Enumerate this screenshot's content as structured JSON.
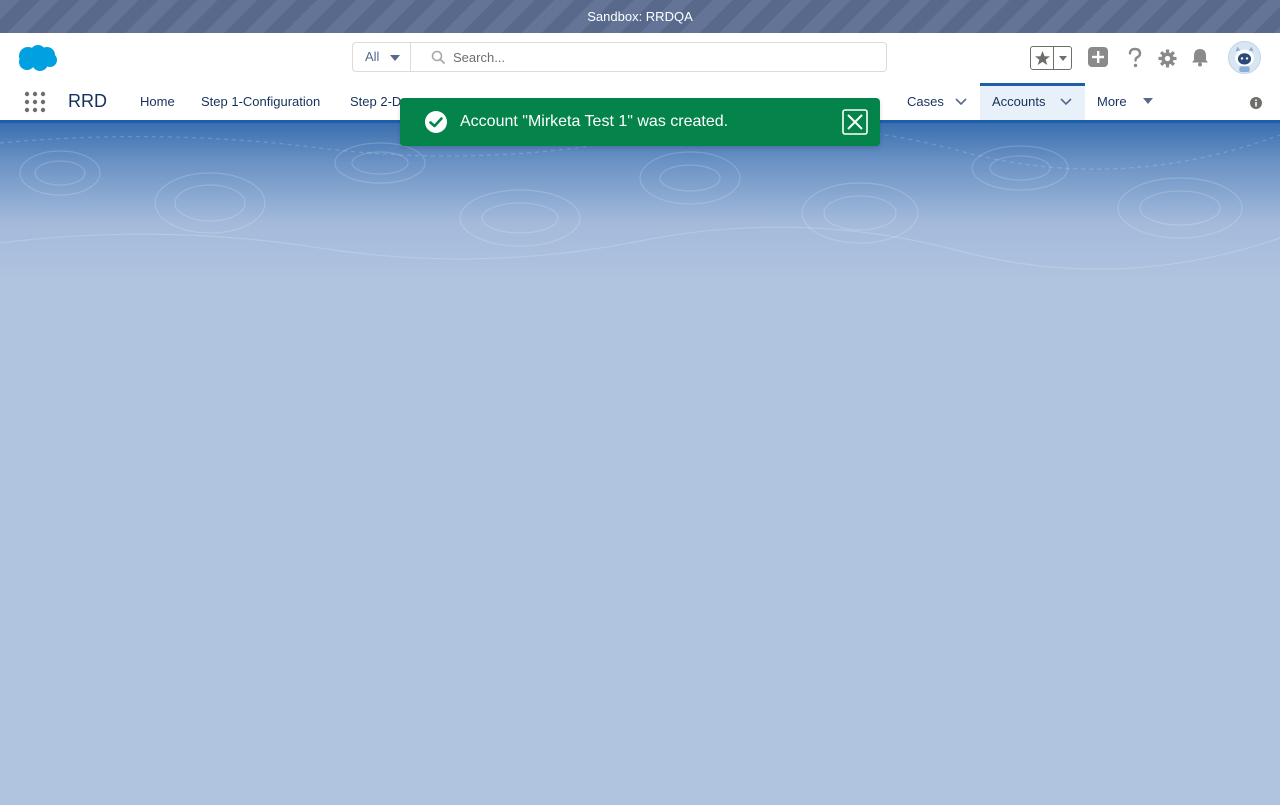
{
  "sandbox": {
    "label": "Sandbox: RRDQA"
  },
  "header": {
    "search_scope": "All",
    "search_placeholder": "Search..."
  },
  "nav": {
    "app_name": "RRD",
    "items": [
      {
        "label": "Home"
      },
      {
        "label": "Step 1-Configuration"
      },
      {
        "label": "Step 2-D"
      },
      {
        "label": "Cases"
      },
      {
        "label": "Accounts"
      },
      {
        "label": "More"
      }
    ]
  },
  "toast": {
    "message": "Account \"Mirketa Test 1\" was created.",
    "variant": "success"
  },
  "icons": {
    "logo": "salesforce-cloud-icon",
    "search": "search-icon",
    "favorites": "star-icon",
    "global_create": "plus-icon",
    "help": "question-icon",
    "setup": "gear-icon",
    "notifications": "bell-icon",
    "avatar": "astro-avatar-icon",
    "app_launcher": "waffle-icon",
    "info": "info-icon",
    "toast_status": "check-circle-icon",
    "toast_close": "close-icon"
  },
  "colors": {
    "sandbox_bar": "#5b6d91",
    "brand_blue": "#1b5fab",
    "toast_success": "#04844b",
    "page_background": "#b0c4df"
  }
}
